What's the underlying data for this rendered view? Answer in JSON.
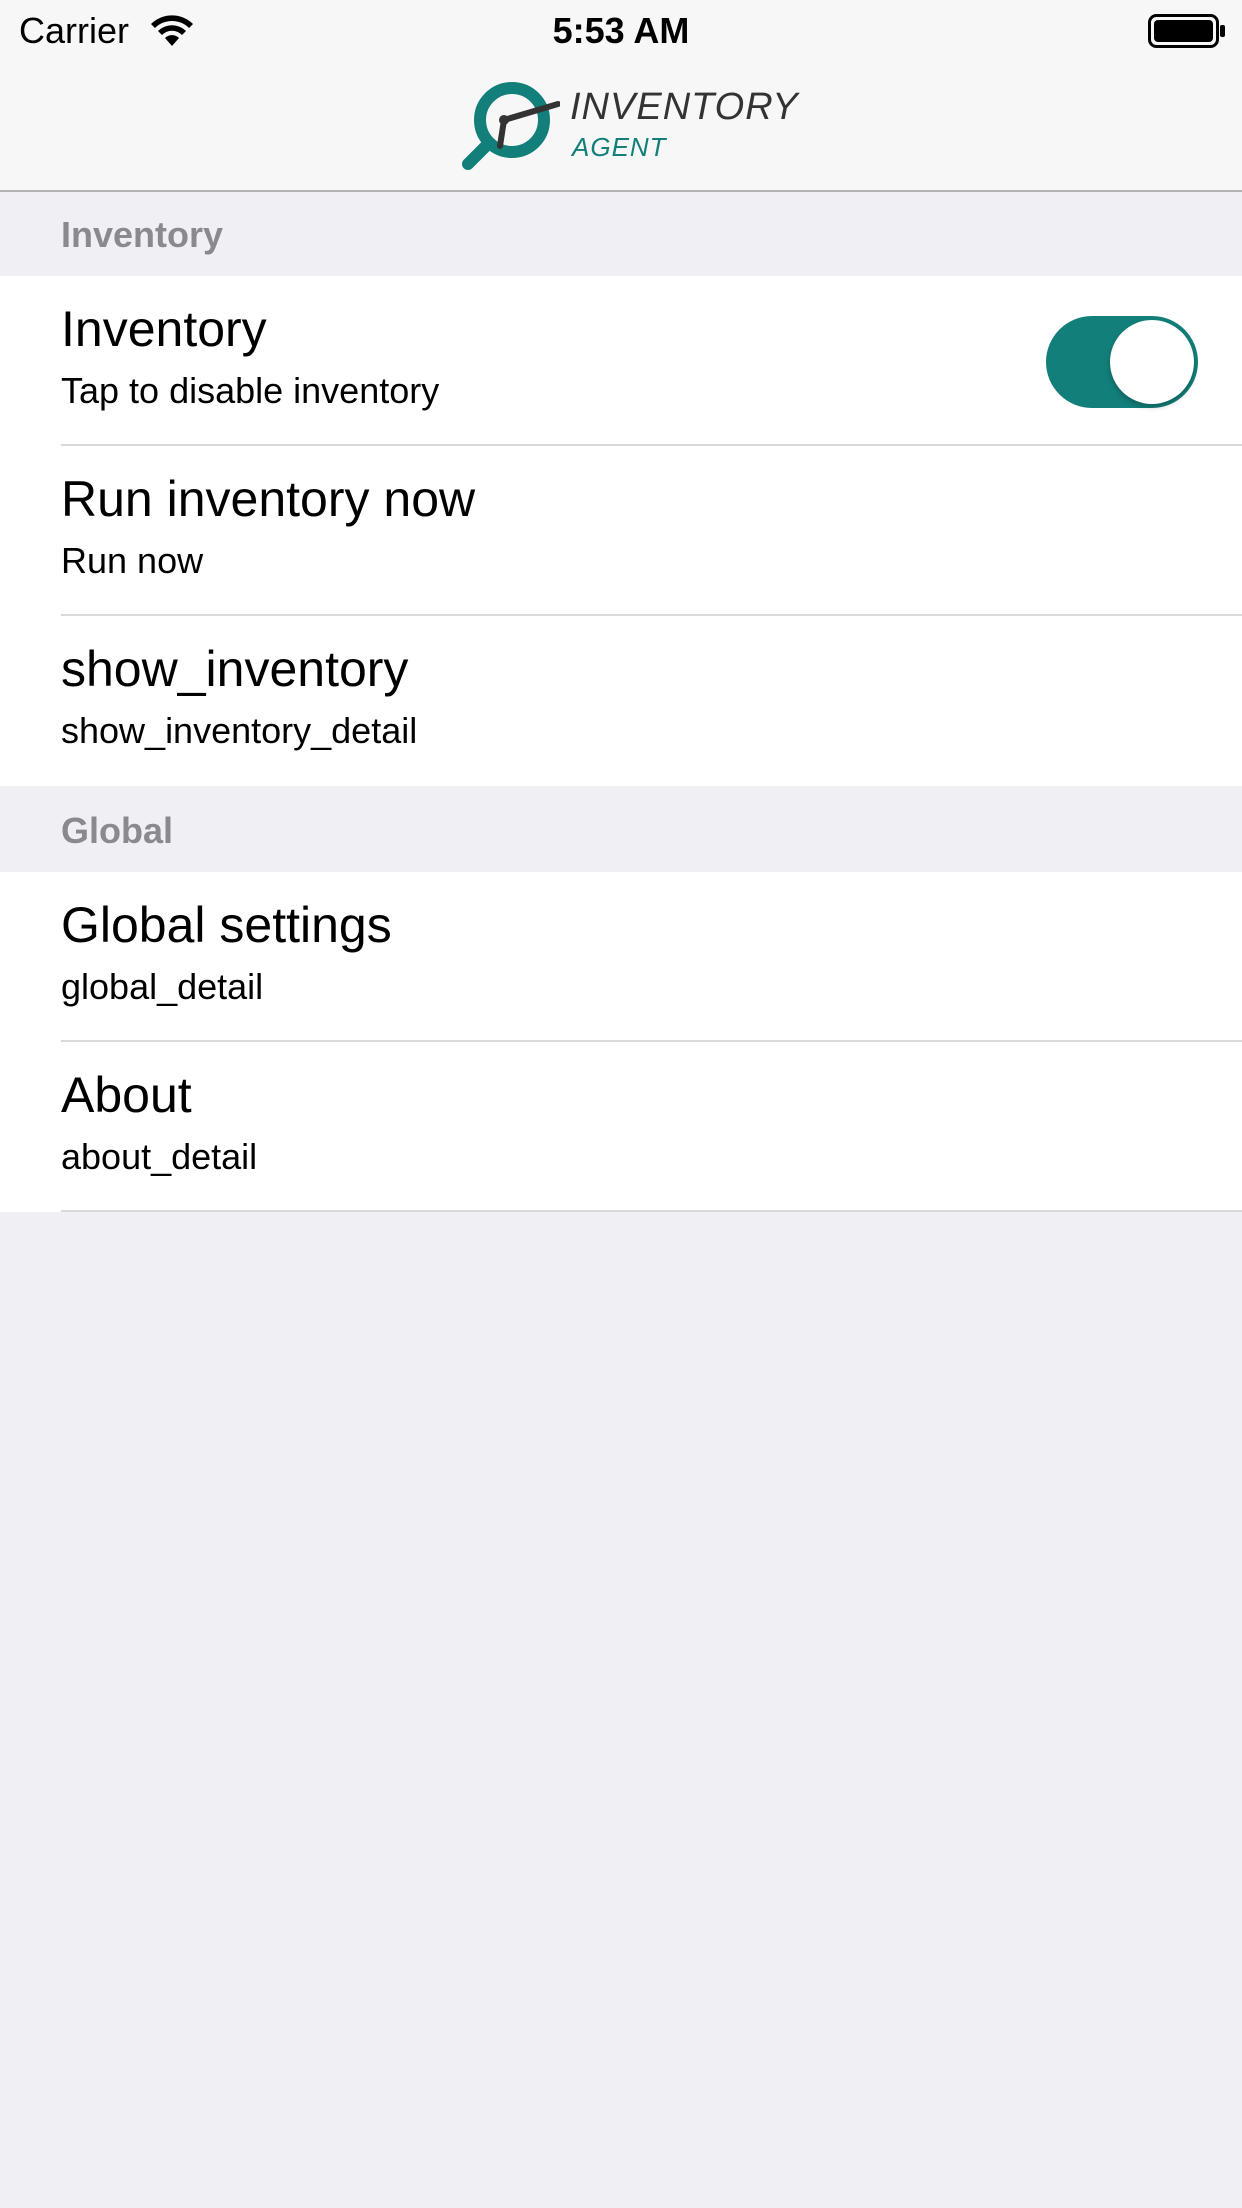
{
  "status_bar": {
    "carrier": "Carrier",
    "time": "5:53 AM"
  },
  "nav_bar": {
    "logo_title": "INVENTORY",
    "logo_subtitle": "AGENT",
    "accent_color": "#137f7a"
  },
  "sections": [
    {
      "header": "Inventory",
      "rows": [
        {
          "title": "Inventory",
          "detail": "Tap to disable inventory",
          "toggle_on": true
        },
        {
          "title": "Run inventory now",
          "detail": "Run now"
        },
        {
          "title": "show_inventory",
          "detail": "show_inventory_detail"
        }
      ]
    },
    {
      "header": "Global",
      "rows": [
        {
          "title": "Global settings",
          "detail": "global_detail"
        },
        {
          "title": "About",
          "detail": "about_detail"
        }
      ]
    }
  ],
  "icons": [
    "wifi-icon",
    "battery-icon",
    "inventory-agent-logo-icon"
  ]
}
